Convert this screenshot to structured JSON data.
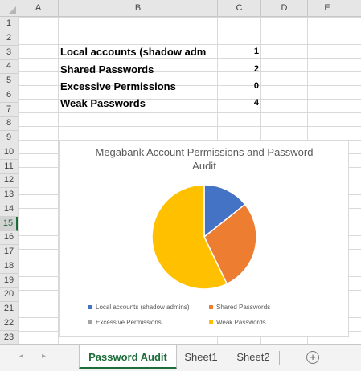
{
  "columns": [
    "A",
    "B",
    "C",
    "D",
    "E"
  ],
  "rows": [
    "1",
    "2",
    "3",
    "4",
    "5",
    "6",
    "7",
    "8",
    "9",
    "10",
    "11",
    "12",
    "13",
    "14",
    "15",
    "16",
    "17",
    "18",
    "19",
    "20",
    "21",
    "22",
    "23"
  ],
  "active_row": "15",
  "table": [
    {
      "label": "Local accounts (shadow admins)",
      "label_display": "Local accounts (shadow adm",
      "value": "1"
    },
    {
      "label": "Shared Passwords",
      "label_display": "Shared Passwords",
      "value": "2"
    },
    {
      "label": "Excessive Permissions",
      "label_display": "Excessive Permissions",
      "value": "0"
    },
    {
      "label": "Weak Passwords",
      "label_display": "Weak Passwords",
      "value": "4"
    }
  ],
  "chart_data": {
    "type": "pie",
    "title": "Megabank Account Permissions and Password Audit",
    "categories": [
      "Local accounts (shadow admins)",
      "Shared Passwords",
      "Excessive Permissions",
      "Weak Passwords"
    ],
    "values": [
      1,
      2,
      0,
      4
    ],
    "colors": [
      "#4472c4",
      "#ed7d31",
      "#a5a5a5",
      "#ffc000"
    ],
    "legend_position": "bottom"
  },
  "tabs": [
    {
      "label": "Password Audit",
      "active": true
    },
    {
      "label": "Sheet1",
      "active": false
    },
    {
      "label": "Sheet2",
      "active": false
    }
  ],
  "tabbar": {
    "prev_icon": "◂",
    "next_icon": "▸",
    "add_icon": "+"
  }
}
